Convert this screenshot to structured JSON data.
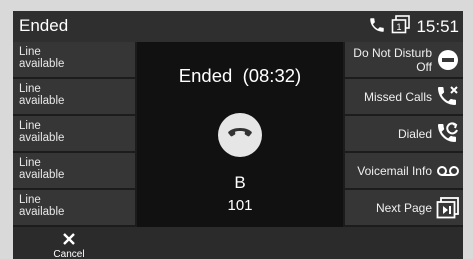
{
  "header": {
    "title": "Ended",
    "time": "15:51",
    "phone_icon": "phone-icon",
    "line_icon": "line-one-icon",
    "line_number": "1"
  },
  "lines": [
    {
      "label": "Line\navailable"
    },
    {
      "label": "Line\navailable"
    },
    {
      "label": "Line\navailable"
    },
    {
      "label": "Line\navailable"
    },
    {
      "label": "Line\navailable"
    }
  ],
  "call": {
    "status": "Ended  (08:32)",
    "name": "B",
    "number": "101",
    "end_icon": "hangup-icon"
  },
  "softkeys": {
    "dnd": {
      "line1": "Do Not Disturb",
      "line2": "Off",
      "icon": "dnd-icon"
    },
    "missed": {
      "label": "Missed Calls",
      "icon": "missed-call-icon"
    },
    "dialed": {
      "label": "Dialed",
      "icon": "dialed-call-icon"
    },
    "voicemail": {
      "label": "Voicemail Info",
      "icon": "voicemail-icon"
    },
    "nextpage": {
      "label": "Next Page",
      "icon": "next-page-icon"
    }
  },
  "bottom": {
    "cancel_label": "Cancel",
    "cancel_icon": "close-icon"
  },
  "colors": {
    "background": "#1c1c1c",
    "panel": "#363636",
    "text": "#ffffff",
    "button": "#e6e6e6"
  }
}
